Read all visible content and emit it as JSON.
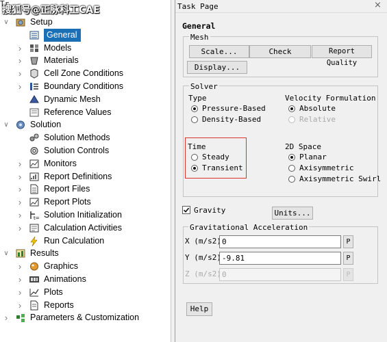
{
  "watermark": "搜狐号@正脉科工CAE",
  "tree": {
    "header_text": "Tr",
    "items": [
      {
        "label": "Setup",
        "icon": "setup-icon"
      },
      {
        "label": "General",
        "icon": "general-icon"
      },
      {
        "label": "Models",
        "icon": "models-icon"
      },
      {
        "label": "Materials",
        "icon": "materials-icon"
      },
      {
        "label": "Cell Zone Conditions",
        "icon": "cell-zone-icon"
      },
      {
        "label": "Boundary Conditions",
        "icon": "boundary-icon"
      },
      {
        "label": "Dynamic Mesh",
        "icon": "dynamic-mesh-icon"
      },
      {
        "label": "Reference Values",
        "icon": "reference-values-icon"
      },
      {
        "label": "Solution",
        "icon": "solution-icon"
      },
      {
        "label": "Solution Methods",
        "icon": "solution-methods-icon"
      },
      {
        "label": "Solution Controls",
        "icon": "solution-controls-icon"
      },
      {
        "label": "Monitors",
        "icon": "monitors-icon"
      },
      {
        "label": "Report Definitions",
        "icon": "report-definitions-icon"
      },
      {
        "label": "Report Files",
        "icon": "report-files-icon"
      },
      {
        "label": "Report Plots",
        "icon": "report-plots-icon"
      },
      {
        "label": "Solution Initialization",
        "icon": "solution-init-icon"
      },
      {
        "label": "Calculation Activities",
        "icon": "calc-activities-icon"
      },
      {
        "label": "Run Calculation",
        "icon": "run-calculation-icon"
      },
      {
        "label": "Results",
        "icon": "results-icon"
      },
      {
        "label": "Graphics",
        "icon": "graphics-icon"
      },
      {
        "label": "Animations",
        "icon": "animations-icon"
      },
      {
        "label": "Plots",
        "icon": "plots-icon"
      },
      {
        "label": "Reports",
        "icon": "reports-icon"
      },
      {
        "label": "Parameters & Customization",
        "icon": "parameters-icon"
      }
    ]
  },
  "panel": {
    "title": "Task Page",
    "heading": "General",
    "mesh": {
      "label": "Mesh",
      "scale": "Scale...",
      "check": "Check",
      "report_quality": "Report Quality",
      "display": "Display..."
    },
    "solver": {
      "label": "Solver",
      "type_label": "Type",
      "type_options": [
        "Pressure-Based",
        "Density-Based"
      ],
      "type_selected": "Pressure-Based",
      "velocity_label": "Velocity Formulation",
      "velocity_options": [
        "Absolute",
        "Relative"
      ],
      "velocity_selected": "Absolute",
      "time_label": "Time",
      "time_options": [
        "Steady",
        "Transient"
      ],
      "time_selected": "Transient",
      "space_label": "2D Space",
      "space_options": [
        "Planar",
        "Axisymmetric",
        "Axisymmetric Swirl"
      ],
      "space_selected": "Planar"
    },
    "gravity": {
      "label": "Gravity",
      "checked": true,
      "units_button": "Units...",
      "accel_label": "Gravitational Acceleration",
      "x_label": "X (m/s2)",
      "x_value": "0",
      "y_label": "Y (m/s2)",
      "y_value": "-9.81",
      "z_label": "Z (m/s2)",
      "z_value": "0",
      "param_button": "P"
    },
    "help_button": "Help",
    "highlight_color": "#d9342b"
  }
}
